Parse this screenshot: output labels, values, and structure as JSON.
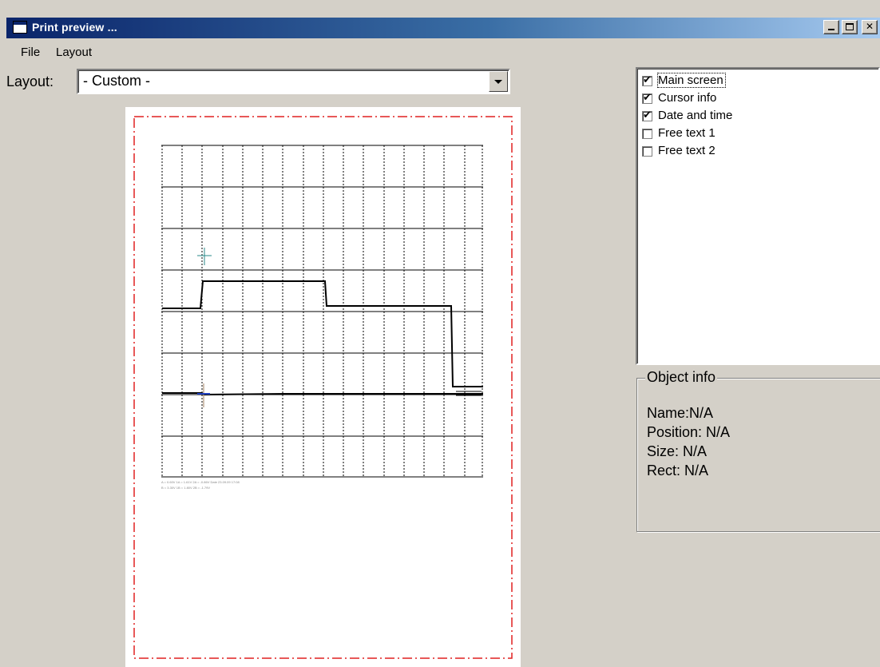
{
  "window": {
    "title": "Print preview ...",
    "buttons": {
      "minimize": "minimize",
      "maximize": "maximize",
      "close": "close"
    }
  },
  "menu": {
    "file": "File",
    "layout": "Layout"
  },
  "layout_selector": {
    "label": "Layout:",
    "value": "- Custom -"
  },
  "checklist": {
    "items": [
      {
        "label": "Main screen",
        "checked": true
      },
      {
        "label": "Cursor info",
        "checked": true
      },
      {
        "label": "Date and time",
        "checked": true
      },
      {
        "label": "Free text 1",
        "checked": false
      },
      {
        "label": "Free text 2",
        "checked": false
      }
    ]
  },
  "object_info": {
    "title": "Object info",
    "name": "Name:N/A",
    "position": "Position: N/A",
    "size": "Size:   N/A",
    "rect": "Rect:  N/A"
  },
  "preview": {
    "cursor_line_1": "A = 0.60V  1A = 1.61V  2A = -0.86V    Date 23.09.09 17:08",
    "cursor_line_2": "B = 3.30V  1B = 1.80V  2B = -1.79V"
  },
  "colors": {
    "titlebar_start": "#0a246a",
    "titlebar_end": "#a6caf0",
    "page_border": "#e02020",
    "trace": "#000000",
    "cursor_a": "#2a8a8a",
    "cursor_b": "#2040c0"
  }
}
